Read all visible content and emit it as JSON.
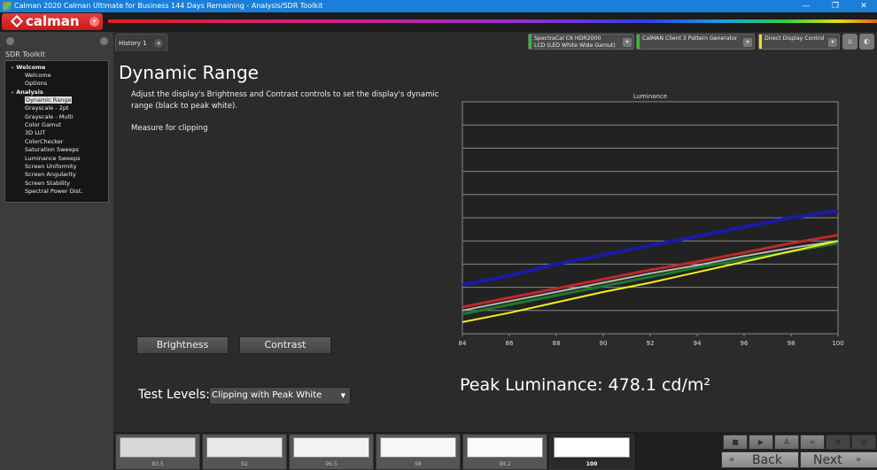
{
  "window": {
    "title": "Calman 2020 Calman Ultimate for Business 144 Days Remaining  - Analysis/SDR Toolkit",
    "controls": [
      "—",
      "❐",
      "✕"
    ]
  },
  "brand": {
    "name": "calman",
    "menu_icon": "chevron-down-icon"
  },
  "sidebar": {
    "header": "SDR Toolkit",
    "groups": [
      {
        "label": "Welcome",
        "items": [
          "Welcome",
          "Options"
        ]
      },
      {
        "label": "Analysis",
        "items": [
          "Dynamic Range",
          "Grayscale - 2pt",
          "Grayscale - Multi",
          "Color Gamut",
          "3D LUT",
          "ColorChecker",
          "Saturation Sweeps",
          "Luminance Sweeps",
          "Screen Uniformity",
          "Screen Angularity",
          "Screen Stability",
          "Spectral Power Dist."
        ]
      }
    ],
    "selected": "Dynamic Range"
  },
  "tabs": [
    {
      "label": "History 1"
    }
  ],
  "devices": [
    {
      "line1": "SpectraCal C6 HDR2000",
      "line2": "LCD (LED White Wide Gamut)",
      "color": "#2ec02e"
    },
    {
      "line1": "CalMAN Client 3 Pattern Generator",
      "line2": "",
      "color": "#2ec02e"
    },
    {
      "line1": "Direct Display Control",
      "line2": "",
      "color": "#e8e020"
    }
  ],
  "page": {
    "title": "Dynamic Range",
    "description": "Adjust the display's Brightness and Contrast controls to set the display's dynamic range (black to peak white).",
    "instruction": "Measure for clipping",
    "brightness_label": "Brightness",
    "contrast_label": "Contrast",
    "test_levels_label": "Test Levels:",
    "test_levels_value": "Clipping with Peak White",
    "peak_luminance": "Peak Luminance: 478.1  cd/m²"
  },
  "chart_data": {
    "type": "line",
    "title": "Luminance",
    "xlabel": "",
    "ylabel": "",
    "x": [
      84,
      86,
      88,
      90,
      92,
      94,
      96,
      98,
      100
    ],
    "xlim": [
      84,
      100
    ],
    "ylim": [
      0,
      10
    ],
    "grid": true,
    "series": [
      {
        "name": "Blue",
        "color": "#1a1aa8",
        "values": [
          2.1,
          2.5,
          3.0,
          3.4,
          3.8,
          4.2,
          4.6,
          5.0,
          5.3
        ]
      },
      {
        "name": "Red",
        "color": "#c0282a",
        "values": [
          1.15,
          1.55,
          1.95,
          2.35,
          2.75,
          3.1,
          3.5,
          3.9,
          4.25
        ]
      },
      {
        "name": "White",
        "color": "#b8b8b8",
        "values": [
          1.0,
          1.4,
          1.8,
          2.2,
          2.6,
          2.95,
          3.35,
          3.7,
          4.0
        ]
      },
      {
        "name": "Green",
        "color": "#1c7a2a",
        "values": [
          0.85,
          1.25,
          1.65,
          2.05,
          2.45,
          2.85,
          3.2,
          3.55,
          3.9
        ]
      },
      {
        "name": "Yellow",
        "color": "#f0f020",
        "values": [
          0.5,
          0.9,
          1.35,
          1.8,
          2.2,
          2.65,
          3.1,
          3.55,
          4.0
        ]
      }
    ]
  },
  "swatches": [
    {
      "label": "83.5",
      "color": "#d8d8d8"
    },
    {
      "label": "92",
      "color": "#e8e8e8"
    },
    {
      "label": "96.5",
      "color": "#f2f2f2"
    },
    {
      "label": "98",
      "color": "#f7f7f7"
    },
    {
      "label": "99.2",
      "color": "#fafafa"
    },
    {
      "label": "100",
      "color": "#ffffff",
      "selected": true
    }
  ],
  "controls": {
    "buttons": [
      "stop-icon",
      "play-icon",
      "save-icon",
      "loop-icon",
      "settings-icon",
      "target-icon"
    ],
    "back_label": "Back",
    "next_label": "Next"
  }
}
